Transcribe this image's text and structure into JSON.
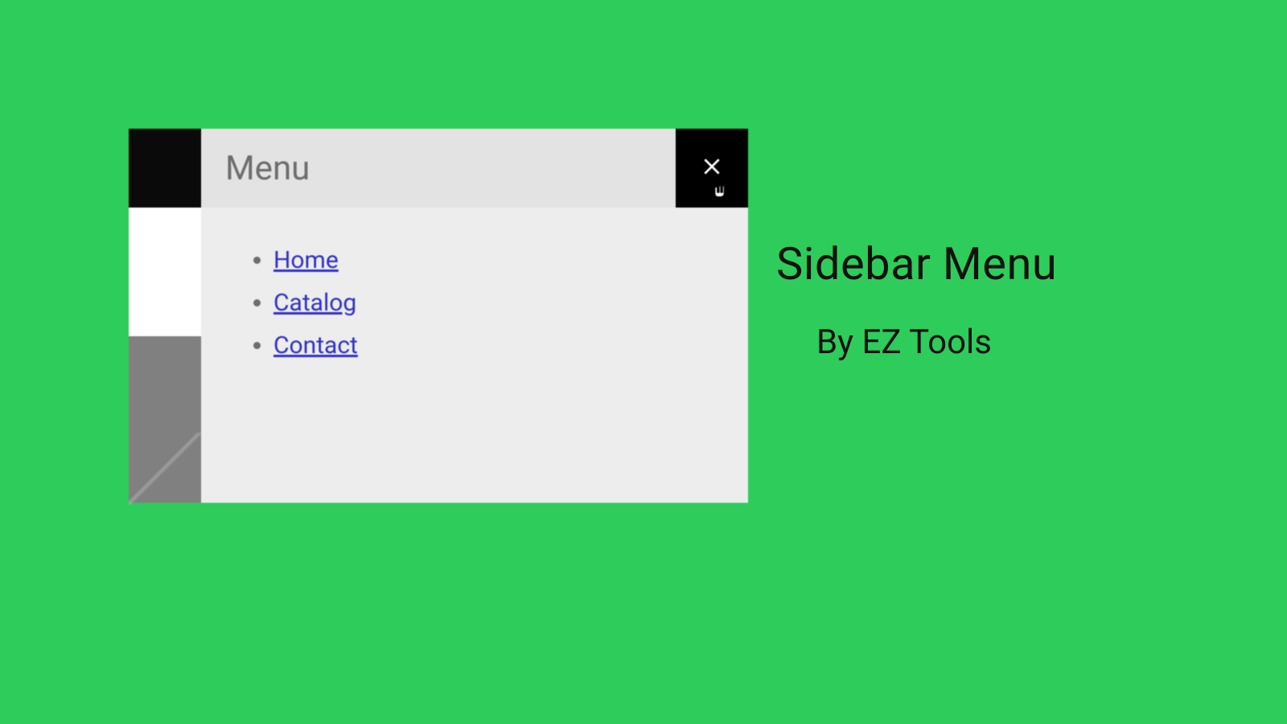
{
  "menu": {
    "title": "Menu",
    "items": [
      "Home",
      "Catalog",
      "Contact"
    ]
  },
  "caption": {
    "title": "Sidebar Menu",
    "subtitle": "By EZ Tools"
  }
}
